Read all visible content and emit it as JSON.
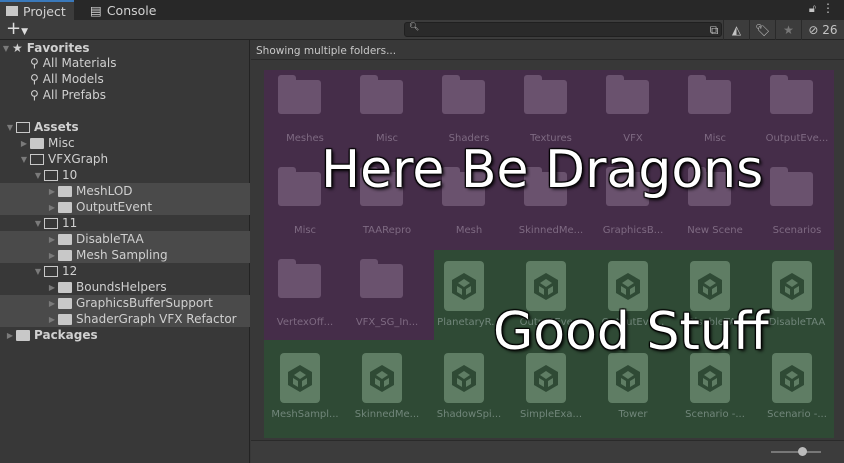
{
  "tabs": [
    {
      "label": "Project",
      "icon": "folder-icon"
    },
    {
      "label": "Console",
      "icon": "console-icon"
    }
  ],
  "toolbar": {
    "add": "+",
    "search_placeholder": "",
    "hidden_count": "26"
  },
  "favorites": {
    "label": "Favorites",
    "items": [
      "All Materials",
      "All Models",
      "All Prefabs"
    ]
  },
  "tree": [
    {
      "label": "Assets",
      "depth": 0,
      "open": true,
      "bold": true,
      "sel": false
    },
    {
      "label": "Misc",
      "depth": 1,
      "open": false,
      "sel": false
    },
    {
      "label": "VFXGraph",
      "depth": 1,
      "open": true,
      "sel": false
    },
    {
      "label": "10",
      "depth": 2,
      "open": true,
      "sel": false
    },
    {
      "label": "MeshLOD",
      "depth": 3,
      "open": false,
      "sel": true
    },
    {
      "label": "OutputEvent",
      "depth": 3,
      "open": false,
      "sel": true
    },
    {
      "label": "11",
      "depth": 2,
      "open": true,
      "sel": false
    },
    {
      "label": "DisableTAA",
      "depth": 3,
      "open": false,
      "sel": true
    },
    {
      "label": "Mesh Sampling",
      "depth": 3,
      "open": false,
      "sel": true
    },
    {
      "label": "12",
      "depth": 2,
      "open": true,
      "sel": false
    },
    {
      "label": "BoundsHelpers",
      "depth": 3,
      "open": false,
      "sel": false
    },
    {
      "label": "GraphicsBufferSupport",
      "depth": 3,
      "open": false,
      "sel": true
    },
    {
      "label": "ShaderGraph VFX Refactor",
      "depth": 3,
      "open": false,
      "sel": true
    },
    {
      "label": "Packages",
      "depth": 0,
      "open": false,
      "bold": true,
      "sel": false
    }
  ],
  "status": "Showing multiple folders...",
  "colors": {
    "dragons": "#452d49",
    "good": "#2f4a35"
  },
  "grid": [
    {
      "label": "Meshes",
      "type": "folder"
    },
    {
      "label": "Misc",
      "type": "folder"
    },
    {
      "label": "Shaders",
      "type": "folder"
    },
    {
      "label": "Textures",
      "type": "folder"
    },
    {
      "label": "VFX",
      "type": "folder"
    },
    {
      "label": "Misc",
      "type": "folder"
    },
    {
      "label": "OutputEve...",
      "type": "folder"
    },
    {
      "label": "Misc",
      "type": "folder"
    },
    {
      "label": "TAARepro",
      "type": "folder"
    },
    {
      "label": "Mesh",
      "type": "folder"
    },
    {
      "label": "SkinnedMe...",
      "type": "folder"
    },
    {
      "label": "GraphicsB...",
      "type": "folder"
    },
    {
      "label": "New Scene",
      "type": "folder"
    },
    {
      "label": "Scenarios",
      "type": "folder"
    },
    {
      "label": "VertexOff...",
      "type": "folder"
    },
    {
      "label": "VFX_SG_In...",
      "type": "folder"
    },
    {
      "label": "PlanetaryR...",
      "type": "scene"
    },
    {
      "label": "OutputEve...",
      "type": "scene"
    },
    {
      "label": "OutputEve...",
      "type": "scene"
    },
    {
      "label": "DisableTAA",
      "type": "scene"
    },
    {
      "label": "DisableTAA",
      "type": "scene"
    },
    {
      "label": "MeshSampl...",
      "type": "scene"
    },
    {
      "label": "SkinnedMe...",
      "type": "scene"
    },
    {
      "label": "ShadowSpi...",
      "type": "scene"
    },
    {
      "label": "SimpleExa...",
      "type": "scene"
    },
    {
      "label": "Tower",
      "type": "scene"
    },
    {
      "label": "Scenario -...",
      "type": "scene"
    },
    {
      "label": "Scenario -...",
      "type": "scene"
    }
  ],
  "overlays": {
    "dragons": "Here Be Dragons",
    "good": "Good Stuff"
  }
}
